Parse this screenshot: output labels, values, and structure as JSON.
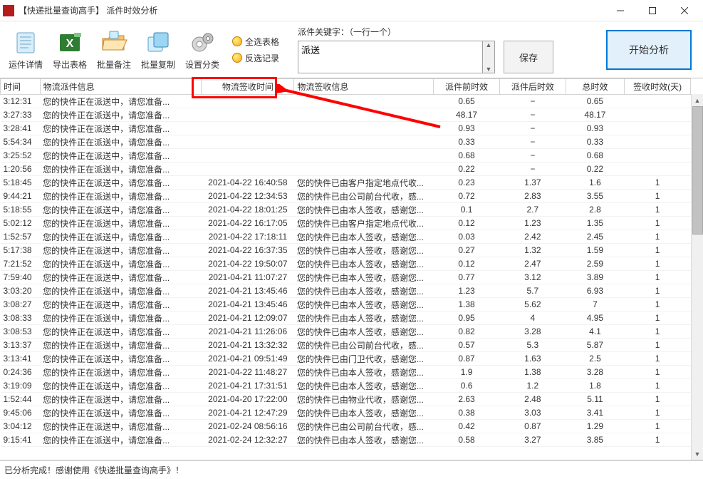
{
  "window": {
    "title": "【快递批量查询高手】 派件时效分析"
  },
  "toolbar": {
    "items": [
      {
        "label": "运件详情"
      },
      {
        "label": "导出表格"
      },
      {
        "label": "批量备注"
      },
      {
        "label": "批量复制"
      },
      {
        "label": "设置分类"
      }
    ],
    "small": [
      {
        "label": "全选表格"
      },
      {
        "label": "反选记录"
      }
    ],
    "keyword_label": "派件关键字：（一行一个）",
    "keyword_value": "派送",
    "save": "保存",
    "analyze": "开始分析"
  },
  "columns": {
    "c0": "时间",
    "c1": "物流派件信息",
    "c2": "物流签收时间",
    "c3": "物流签收信息",
    "c4": "派件前时效",
    "c5": "派件后时效",
    "c6": "总时效",
    "c7": "签收时效(天)"
  },
  "rows": [
    {
      "t": "3:12:31",
      "d": "您的快件正在派送中，请您准备...",
      "st": "",
      "si": "",
      "pre": "0.65",
      "post": "−",
      "tot": "0.65",
      "sd": ""
    },
    {
      "t": "3:27:33",
      "d": "您的快件正在派送中，请您准备...",
      "st": "",
      "si": "",
      "pre": "48.17",
      "post": "−",
      "tot": "48.17",
      "sd": ""
    },
    {
      "t": "3:28:41",
      "d": "您的快件正在派送中，请您准备...",
      "st": "",
      "si": "",
      "pre": "0.93",
      "post": "−",
      "tot": "0.93",
      "sd": ""
    },
    {
      "t": "5:54:34",
      "d": "您的快件正在派送中，请您准备...",
      "st": "",
      "si": "",
      "pre": "0.33",
      "post": "−",
      "tot": "0.33",
      "sd": ""
    },
    {
      "t": "3:25:52",
      "d": "您的快件正在派送中，请您准备...",
      "st": "",
      "si": "",
      "pre": "0.68",
      "post": "−",
      "tot": "0.68",
      "sd": ""
    },
    {
      "t": "1:20:56",
      "d": "您的快件正在派送中，请您准备...",
      "st": "",
      "si": "",
      "pre": "0.22",
      "post": "−",
      "tot": "0.22",
      "sd": ""
    },
    {
      "t": "5:18:45",
      "d": "您的快件正在派送中，请您准备...",
      "st": "2021-04-22 16:40:58",
      "si": "您的快件已由客户指定地点代收...",
      "pre": "0.23",
      "post": "1.37",
      "tot": "1.6",
      "sd": "1"
    },
    {
      "t": "9:44:21",
      "d": "您的快件正在派送中，请您准备...",
      "st": "2021-04-22 12:34:53",
      "si": "您的快件已由公司前台代收，感...",
      "pre": "0.72",
      "post": "2.83",
      "tot": "3.55",
      "sd": "1"
    },
    {
      "t": "5:18:55",
      "d": "您的快件正在派送中，请您准备...",
      "st": "2021-04-22 18:01:25",
      "si": "您的快件已由本人签收，感谢您...",
      "pre": "0.1",
      "post": "2.7",
      "tot": "2.8",
      "sd": "1"
    },
    {
      "t": "5:02:12",
      "d": "您的快件正在派送中，请您准备...",
      "st": "2021-04-22 16:17:05",
      "si": "您的快件已由客户指定地点代收...",
      "pre": "0.12",
      "post": "1.23",
      "tot": "1.35",
      "sd": "1"
    },
    {
      "t": "1:52:57",
      "d": "您的快件正在派送中，请您准备...",
      "st": "2021-04-22 17:18:11",
      "si": "您的快件已由本人签收，感谢您...",
      "pre": "0.03",
      "post": "2.42",
      "tot": "2.45",
      "sd": "1"
    },
    {
      "t": "5:17:38",
      "d": "您的快件正在派送中，请您准备...",
      "st": "2021-04-22 16:37:35",
      "si": "您的快件已由本人签收，感谢您...",
      "pre": "0.27",
      "post": "1.32",
      "tot": "1.59",
      "sd": "1"
    },
    {
      "t": "7:21:52",
      "d": "您的快件正在派送中，请您准备...",
      "st": "2021-04-22 19:50:07",
      "si": "您的快件已由本人签收，感谢您...",
      "pre": "0.12",
      "post": "2.47",
      "tot": "2.59",
      "sd": "1"
    },
    {
      "t": "7:59:40",
      "d": "您的快件正在派送中，请您准备...",
      "st": "2021-04-21 11:07:27",
      "si": "您的快件已由本人签收，感谢您...",
      "pre": "0.77",
      "post": "3.12",
      "tot": "3.89",
      "sd": "1"
    },
    {
      "t": "3:03:20",
      "d": "您的快件正在派送中，请您准备...",
      "st": "2021-04-21 13:45:46",
      "si": "您的快件已由本人签收，感谢您...",
      "pre": "1.23",
      "post": "5.7",
      "tot": "6.93",
      "sd": "1"
    },
    {
      "t": "3:08:27",
      "d": "您的快件正在派送中，请您准备...",
      "st": "2021-04-21 13:45:46",
      "si": "您的快件已由本人签收，感谢您...",
      "pre": "1.38",
      "post": "5.62",
      "tot": "7",
      "sd": "1"
    },
    {
      "t": "3:08:33",
      "d": "您的快件正在派送中，请您准备...",
      "st": "2021-04-21 12:09:07",
      "si": "您的快件已由本人签收，感谢您...",
      "pre": "0.95",
      "post": "4",
      "tot": "4.95",
      "sd": "1"
    },
    {
      "t": "3:08:53",
      "d": "您的快件正在派送中，请您准备...",
      "st": "2021-04-21 11:26:06",
      "si": "您的快件已由本人签收，感谢您...",
      "pre": "0.82",
      "post": "3.28",
      "tot": "4.1",
      "sd": "1"
    },
    {
      "t": "3:13:37",
      "d": "您的快件正在派送中，请您准备...",
      "st": "2021-04-21 13:32:32",
      "si": "您的快件已由公司前台代收，感...",
      "pre": "0.57",
      "post": "5.3",
      "tot": "5.87",
      "sd": "1"
    },
    {
      "t": "3:13:41",
      "d": "您的快件正在派送中，请您准备...",
      "st": "2021-04-21 09:51:49",
      "si": "您的快件已由门卫代收，感谢您...",
      "pre": "0.87",
      "post": "1.63",
      "tot": "2.5",
      "sd": "1"
    },
    {
      "t": "0:24:36",
      "d": "您的快件正在派送中，请您准备...",
      "st": "2021-04-22 11:48:27",
      "si": "您的快件已由本人签收，感谢您...",
      "pre": "1.9",
      "post": "1.38",
      "tot": "3.28",
      "sd": "1"
    },
    {
      "t": "3:19:09",
      "d": "您的快件正在派送中，请您准备...",
      "st": "2021-04-21 17:31:51",
      "si": "您的快件已由本人签收，感谢您...",
      "pre": "0.6",
      "post": "1.2",
      "tot": "1.8",
      "sd": "1"
    },
    {
      "t": "1:52:44",
      "d": "您的快件正在派送中，请您准备...",
      "st": "2021-04-20 17:22:00",
      "si": "您的快件已由物业代收，感谢您...",
      "pre": "2.63",
      "post": "2.48",
      "tot": "5.11",
      "sd": "1"
    },
    {
      "t": "9:45:06",
      "d": "您的快件正在派送中，请您准备...",
      "st": "2021-04-21 12:47:29",
      "si": "您的快件已由本人签收，感谢您...",
      "pre": "0.38",
      "post": "3.03",
      "tot": "3.41",
      "sd": "1"
    },
    {
      "t": "3:04:12",
      "d": "您的快件正在派送中，请您准备...",
      "st": "2021-02-24 08:56:16",
      "si": "您的快件已由公司前台代收，感...",
      "pre": "0.42",
      "post": "0.87",
      "tot": "1.29",
      "sd": "1"
    },
    {
      "t": "9:15:41",
      "d": "您的快件正在派送中，请您准备...",
      "st": "2021-02-24 12:32:27",
      "si": "您的快件已由本人签收，感谢您...",
      "pre": "0.58",
      "post": "3.27",
      "tot": "3.85",
      "sd": "1"
    }
  ],
  "status": "已分析完成！感谢使用《快递批量查询高手》！"
}
